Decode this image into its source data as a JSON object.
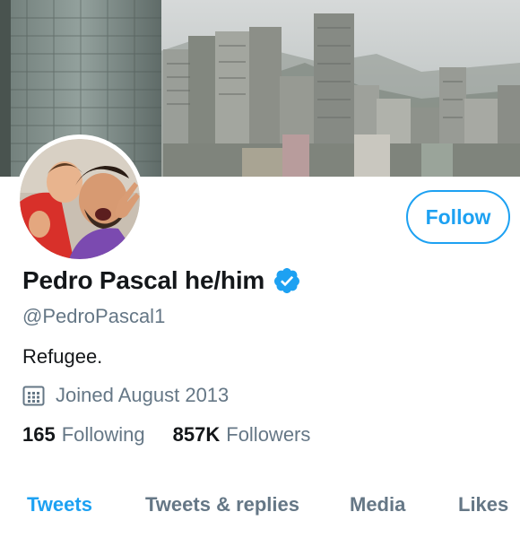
{
  "profile": {
    "display_name": "Pedro Pascal he/him",
    "handle": "@PedroPascal1",
    "bio": "Refugee.",
    "joined": "Joined August 2013",
    "verified": true
  },
  "actions": {
    "follow_label": "Follow"
  },
  "stats": {
    "following_count": "165",
    "following_label": "Following",
    "followers_count": "857K",
    "followers_label": "Followers"
  },
  "tabs": [
    {
      "label": "Tweets",
      "active": true
    },
    {
      "label": "Tweets & replies",
      "active": false
    },
    {
      "label": "Media",
      "active": false
    },
    {
      "label": "Likes",
      "active": false
    }
  ],
  "colors": {
    "accent": "#1da1f2",
    "text_primary": "#14171a",
    "text_secondary": "#657786",
    "verified_badge": "#1da1f2"
  },
  "icons": {
    "verified": "verified-badge-icon",
    "calendar": "calendar-icon"
  }
}
